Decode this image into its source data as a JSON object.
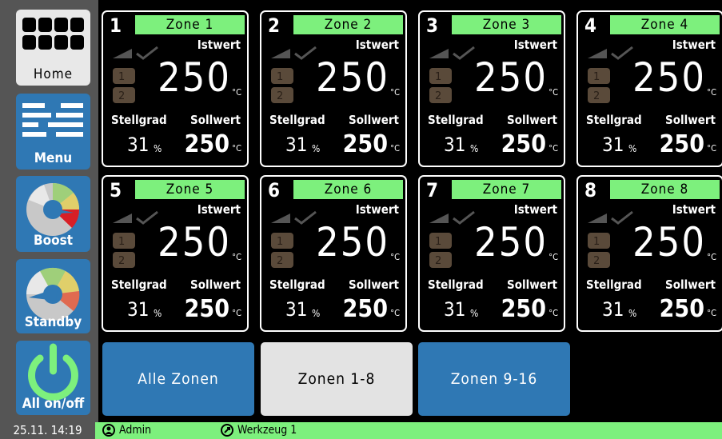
{
  "sidebar": {
    "items": [
      {
        "label": "Home",
        "icon": "grid-icon"
      },
      {
        "label": "Menu",
        "icon": "menu-icon"
      },
      {
        "label": "Boost",
        "icon": "gauge-boost-icon"
      },
      {
        "label": "Standby",
        "icon": "gauge-standby-icon"
      },
      {
        "label": "All on/off",
        "icon": "power-icon"
      }
    ]
  },
  "zones": [
    {
      "num": "1",
      "name": "Zone 1",
      "istwert_label": "Istwert",
      "istwert": "250",
      "istwert_unit": "°C",
      "stellgrad_label": "Stellgrad",
      "stellgrad": "31",
      "stellgrad_unit": "%",
      "sollwert_label": "Sollwert",
      "sollwert": "250",
      "sollwert_unit": "°C"
    },
    {
      "num": "2",
      "name": "Zone 2",
      "istwert_label": "Istwert",
      "istwert": "250",
      "istwert_unit": "°C",
      "stellgrad_label": "Stellgrad",
      "stellgrad": "31",
      "stellgrad_unit": "%",
      "sollwert_label": "Sollwert",
      "sollwert": "250",
      "sollwert_unit": "°C"
    },
    {
      "num": "3",
      "name": "Zone 3",
      "istwert_label": "Istwert",
      "istwert": "250",
      "istwert_unit": "°C",
      "stellgrad_label": "Stellgrad",
      "stellgrad": "31",
      "stellgrad_unit": "%",
      "sollwert_label": "Sollwert",
      "sollwert": "250",
      "sollwert_unit": "°C"
    },
    {
      "num": "4",
      "name": "Zone 4",
      "istwert_label": "Istwert",
      "istwert": "250",
      "istwert_unit": "°C",
      "stellgrad_label": "Stellgrad",
      "stellgrad": "31",
      "stellgrad_unit": "%",
      "sollwert_label": "Sollwert",
      "sollwert": "250",
      "sollwert_unit": "°C"
    },
    {
      "num": "5",
      "name": "Zone 5",
      "istwert_label": "Istwert",
      "istwert": "250",
      "istwert_unit": "°C",
      "stellgrad_label": "Stellgrad",
      "stellgrad": "31",
      "stellgrad_unit": "%",
      "sollwert_label": "Sollwert",
      "sollwert": "250",
      "sollwert_unit": "°C"
    },
    {
      "num": "6",
      "name": "Zone 6",
      "istwert_label": "Istwert",
      "istwert": "250",
      "istwert_unit": "°C",
      "stellgrad_label": "Stellgrad",
      "stellgrad": "31",
      "stellgrad_unit": "%",
      "sollwert_label": "Sollwert",
      "sollwert": "250",
      "sollwert_unit": "°C"
    },
    {
      "num": "7",
      "name": "Zone 7",
      "istwert_label": "Istwert",
      "istwert": "250",
      "istwert_unit": "°C",
      "stellgrad_label": "Stellgrad",
      "stellgrad": "31",
      "stellgrad_unit": "%",
      "sollwert_label": "Sollwert",
      "sollwert": "250",
      "sollwert_unit": "°C"
    },
    {
      "num": "8",
      "name": "Zone 8",
      "istwert_label": "Istwert",
      "istwert": "250",
      "istwert_unit": "°C",
      "stellgrad_label": "Stellgrad",
      "stellgrad": "31",
      "stellgrad_unit": "%",
      "sollwert_label": "Sollwert",
      "sollwert": "250",
      "sollwert_unit": "°C"
    }
  ],
  "zone_buttons": [
    {
      "label": "Alle Zonen",
      "selected": false
    },
    {
      "label": "Zonen 1-8",
      "selected": true
    },
    {
      "label": "Zonen 9-16",
      "selected": false
    }
  ],
  "status": {
    "datetime": "25.11. 14:19",
    "user": "Admin",
    "tool": "Werkzeug 1"
  },
  "colors": {
    "zone_name_bg": "#7df07d",
    "button_blue": "#2f78b4",
    "sidebar_bg": "#555555",
    "status_bg": "#7df07d",
    "alarm_icon": "#5a4a3a"
  }
}
